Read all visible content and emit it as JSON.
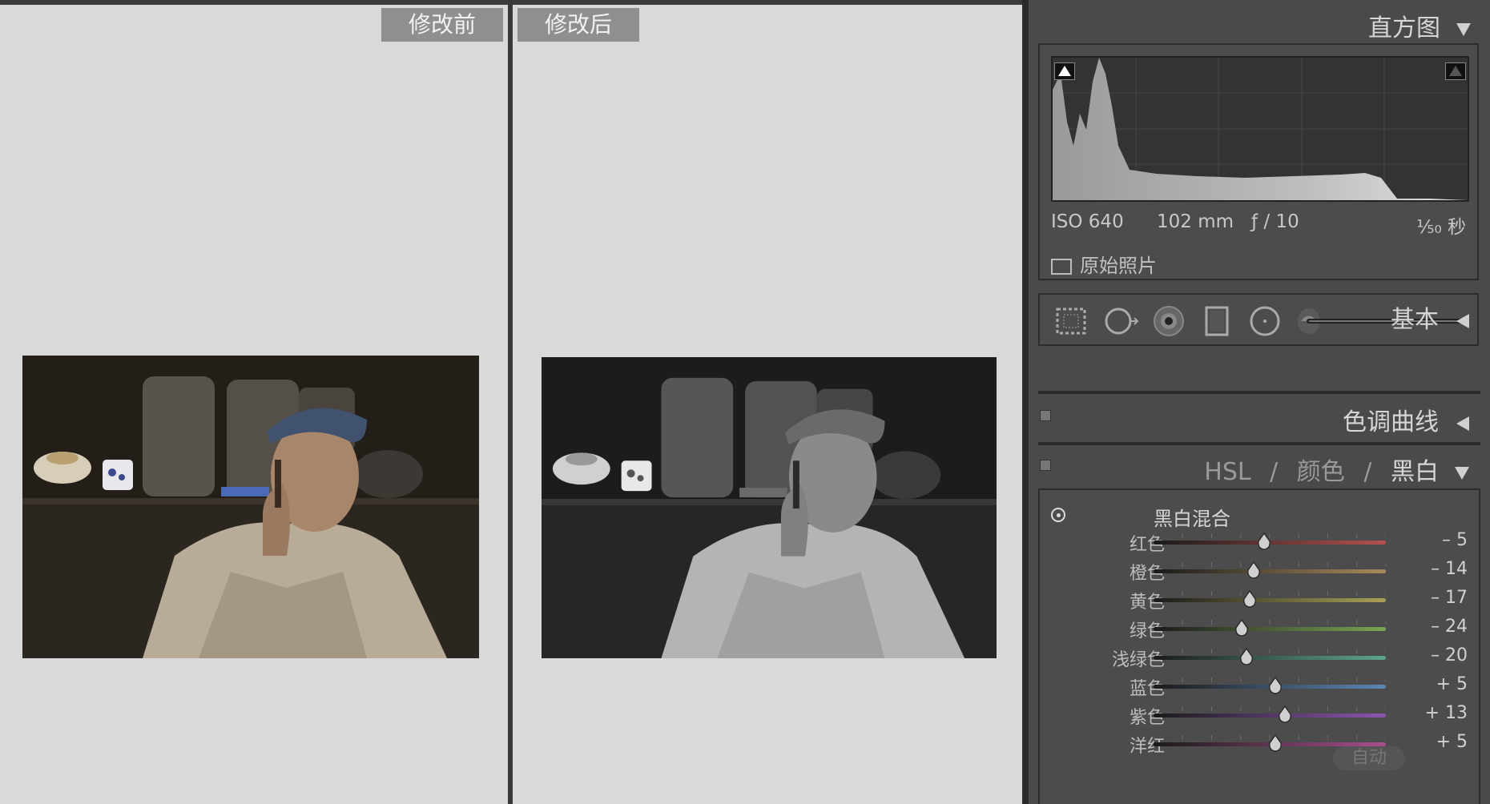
{
  "compare": {
    "before_label": "修改前",
    "after_label": "修改后"
  },
  "histogram": {
    "title": "直方图",
    "iso": "ISO 640",
    "focal": "102 mm",
    "aperture": "ƒ / 10",
    "shutter": "¹⁄₅₀ 秒",
    "original_photo_label": "原始照片"
  },
  "tools": [
    "crop-overlay-icon",
    "spot-removal-icon",
    "red-eye-icon",
    "graduated-filter-icon",
    "radial-filter-icon",
    "adjustment-brush-icon"
  ],
  "sections": {
    "basic": "基本",
    "tone_curve": "色调曲线",
    "hsl_hsl": "HSL",
    "hsl_sep": "/",
    "hsl_color": "颜色",
    "hsl_bw": "黑白"
  },
  "bw_mix": {
    "title": "黑白混合",
    "auto_label": "自动",
    "range": [
      -100,
      100
    ],
    "sliders": [
      {
        "name": "红色",
        "value": -5,
        "display": "– 5",
        "color": "#b3514f"
      },
      {
        "name": "橙色",
        "value": -14,
        "display": "– 14",
        "color": "#a88a5a"
      },
      {
        "name": "黄色",
        "value": -17,
        "display": "– 17",
        "color": "#a8a055"
      },
      {
        "name": "绿色",
        "value": -24,
        "display": "– 24",
        "color": "#7aa453"
      },
      {
        "name": "浅绿色",
        "value": -20,
        "display": "– 20",
        "color": "#5da58d"
      },
      {
        "name": "蓝色",
        "value": 5,
        "display": "+ 5",
        "color": "#5b86b4"
      },
      {
        "name": "紫色",
        "value": 13,
        "display": "+ 13",
        "color": "#8c55b0"
      },
      {
        "name": "洋红",
        "value": 5,
        "display": "+ 5",
        "color": "#a84f8c"
      }
    ]
  }
}
